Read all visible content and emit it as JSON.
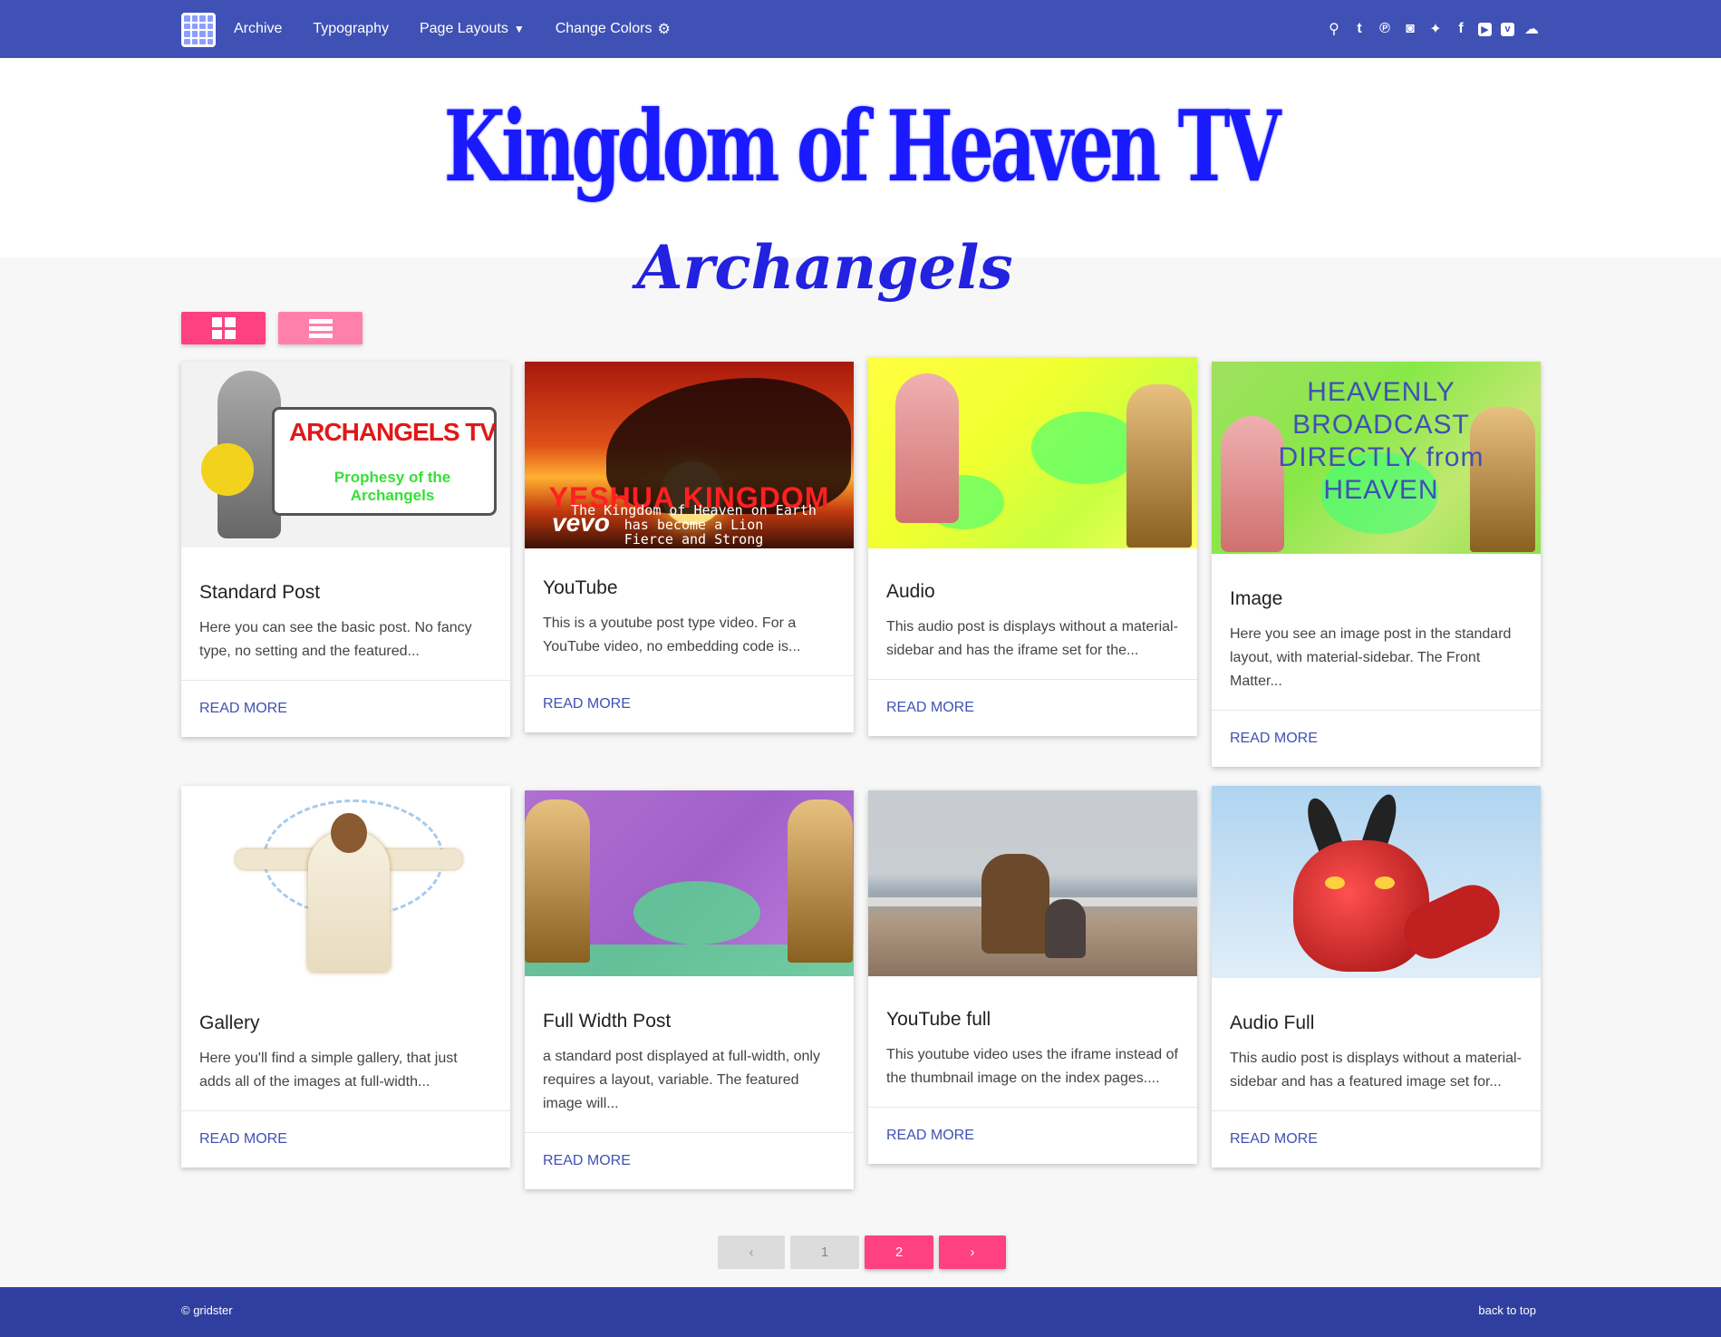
{
  "nav": {
    "links": [
      {
        "label": "Archive"
      },
      {
        "label": "Typography"
      },
      {
        "label": "Page Layouts",
        "caret": "▼"
      },
      {
        "label": "Change Colors",
        "gear": "⚙"
      }
    ],
    "social_icons": [
      "search-icon",
      "tumblr-icon",
      "pinterest-icon",
      "instagram-icon",
      "twitter-icon",
      "facebook-icon",
      "youtube-icon",
      "vimeo-icon",
      "soundcloud-icon"
    ],
    "social_glyphs": [
      "⚲",
      "t",
      "℗",
      "◙",
      "✦",
      "f",
      "▶",
      "v",
      "☁"
    ]
  },
  "banner": {
    "title": "Kingdom of Heaven TV",
    "subtitle": "Archangels"
  },
  "cards": [
    {
      "title": "Standard Post",
      "excerpt": "Here you can see the basic post. No fancy type, no setting and the featured...",
      "read_more": "READ MORE",
      "image_text": {
        "line1": "ARCHANGELS TV",
        "line2": "Prophesy of the",
        "line3": "Archangels"
      }
    },
    {
      "title": "YouTube",
      "excerpt": "This is a youtube post type video. For a YouTube video, no embedding code is...",
      "read_more": "READ MORE",
      "image_text": {
        "line1": "YESHUA KINGDOM",
        "line2": "The Kingdom of Heaven on Earth",
        "line3": "has become a Lion",
        "line4": "Fierce and Strong",
        "logo": "vevo"
      }
    },
    {
      "title": "Audio",
      "excerpt": "This audio post is displays without a material-sidebar and has the iframe set for the...",
      "read_more": "READ MORE"
    },
    {
      "title": "Image",
      "excerpt": "Here you see an image post in the standard layout, with material-sidebar. The Front Matter...",
      "read_more": "READ MORE",
      "image_text": {
        "line1": "HEAVENLY    BROADCAST",
        "line2": "DIRECTLY from HEAVEN"
      }
    },
    {
      "title": "Gallery",
      "excerpt": "Here you'll find a simple gallery, that just adds all of the images at full-width...",
      "read_more": "READ MORE"
    },
    {
      "title": "Full Width Post",
      "excerpt": "a standard post displayed at full-width, only requires a layout, variable. The featured image will...",
      "read_more": "READ MORE"
    },
    {
      "title": "YouTube full",
      "excerpt": "This youtube video uses the iframe instead of the thumbnail image on the index pages....",
      "read_more": "READ MORE"
    },
    {
      "title": "Audio Full",
      "excerpt": "This audio post is displays without a material-sidebar and has a featured image set for...",
      "read_more": "READ MORE"
    }
  ],
  "pagination": {
    "prev": "‹",
    "pages": [
      "1",
      "2"
    ],
    "current": "2",
    "next": "›"
  },
  "footer": {
    "copyright": "© gridster",
    "back_to_top": "back to top"
  },
  "colors": {
    "primary": "#3f51b5",
    "footer": "#303f9f",
    "accent": "#ff4081",
    "accent_light": "#ff80ab"
  }
}
